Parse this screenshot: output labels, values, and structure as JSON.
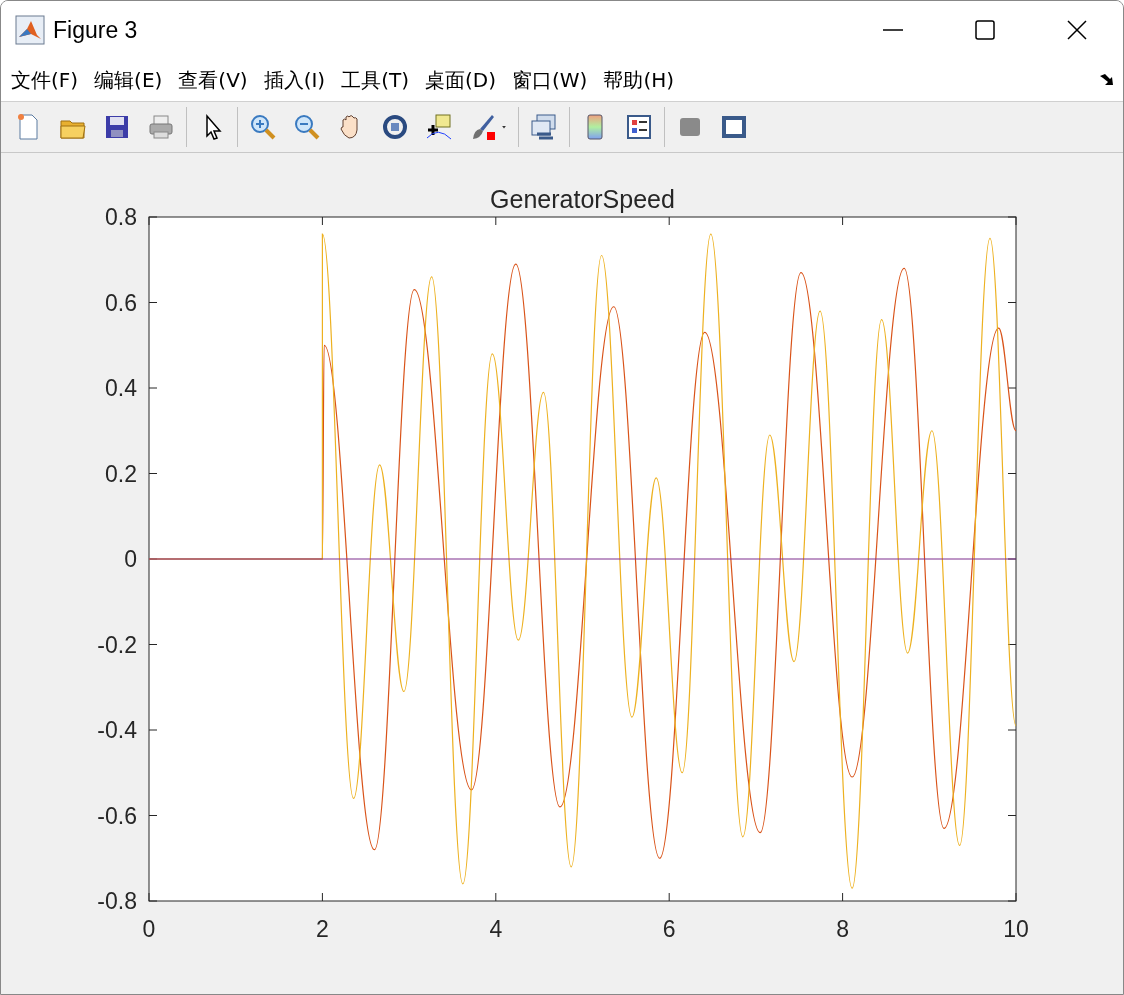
{
  "window": {
    "title": "Figure 3"
  },
  "menu": [
    "文件(F)",
    "编辑(E)",
    "查看(V)",
    "插入(I)",
    "工具(T)",
    "桌面(D)",
    "窗口(W)",
    "帮助(H)"
  ],
  "chart_data": {
    "type": "line",
    "title": "GeneratorSpeed",
    "xlim": [
      0,
      10
    ],
    "ylim": [
      -0.8,
      0.8
    ],
    "xticks": [
      0,
      2,
      4,
      6,
      8,
      10
    ],
    "yticks": [
      -0.8,
      -0.6,
      -0.4,
      -0.2,
      0,
      0.2,
      0.4,
      0.6,
      0.8
    ],
    "series": [
      {
        "color": "#d95319",
        "x": [
          0,
          2,
          2.02,
          2.6,
          3.06,
          3.72,
          4.23,
          4.74,
          5.36,
          5.89,
          6.41,
          7.05,
          7.52,
          8.11,
          8.71,
          9.17,
          9.8,
          10
        ],
        "values": [
          0,
          0,
          0.5,
          -0.68,
          0.63,
          -0.54,
          0.69,
          -0.58,
          0.59,
          -0.7,
          0.53,
          -0.64,
          0.67,
          -0.51,
          0.68,
          -0.63,
          0.54,
          0.3
        ]
      },
      {
        "color": "#edb120",
        "x": [
          0,
          2,
          2,
          2.36,
          2.66,
          2.94,
          3.26,
          3.62,
          3.96,
          4.26,
          4.55,
          4.87,
          5.22,
          5.57,
          5.85,
          6.15,
          6.48,
          6.85,
          7.16,
          7.44,
          7.74,
          8.11,
          8.45,
          8.75,
          9.03,
          9.35,
          9.7,
          10
        ],
        "values": [
          0,
          0,
          0.76,
          -0.56,
          0.22,
          -0.31,
          0.66,
          -0.76,
          0.48,
          -0.19,
          0.39,
          -0.72,
          0.71,
          -0.37,
          0.19,
          -0.5,
          0.76,
          -0.65,
          0.29,
          -0.24,
          0.58,
          -0.77,
          0.56,
          -0.22,
          0.3,
          -0.67,
          0.75,
          -0.39
        ]
      },
      {
        "color": "#7e2f8e",
        "x": [
          0,
          10
        ],
        "values": [
          0,
          0
        ]
      }
    ]
  }
}
